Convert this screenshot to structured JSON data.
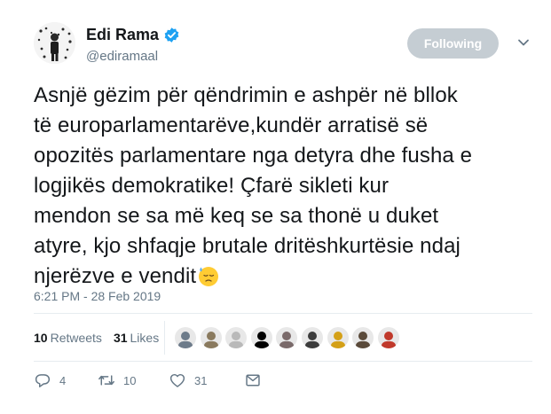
{
  "header": {
    "name": "Edi Rama",
    "handle": "@ediramaal",
    "follow_label": "Following"
  },
  "tweet": {
    "text": "Asnjë gëzim për qëndrimin e ashpër në bllok\ntë europarlamentarëve,kundër arratisë së\nopozitës parlamentare nga detyra dhe fusha e\nlogjikës demokratike! Çfarë sikleti kur\nmendon se sa më keq se sa thonë u duket\natyre, kjo shfaqje brutale dritëshkurtësie ndaj\nnjerëzve e vendit",
    "timestamp": "6:21 PM - 28 Feb 2019"
  },
  "stats": {
    "retweets_count": "10",
    "retweets_label": "Retweets",
    "likes_count": "31",
    "likes_label": "Likes"
  },
  "likers": [
    {
      "color": "#6d7b8a"
    },
    {
      "color": "#8a7a5e"
    },
    {
      "color": "#b9b9b9"
    },
    {
      "color": "#000000"
    },
    {
      "color": "#7a6a6a"
    },
    {
      "color": "#3c3c3c"
    },
    {
      "color": "#d4a017"
    },
    {
      "color": "#5a4a3a"
    },
    {
      "color": "#c0392b"
    }
  ],
  "actions": {
    "replies": "4",
    "retweets": "10",
    "likes": "31"
  },
  "colors": {
    "accent": "#1da1f2",
    "muted": "#657786",
    "button_disabled": "#c5cdd3"
  }
}
